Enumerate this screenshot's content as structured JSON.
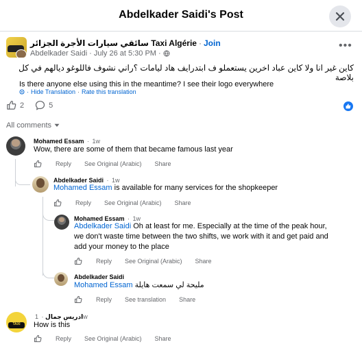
{
  "header": {
    "title": "Abdelkader Saidi's Post"
  },
  "post": {
    "group_name": "سائقي سيارات الأجرة الجزائر Taxi Algérie",
    "join_label": "Join",
    "author": "Abdelkader Saidi",
    "timestamp": "July 26 at 5:30 PM",
    "text": "كاين غير انا ولا كاين عباد اخرين يستعملو ف ابتدرايف هاد ليامات ؟راني نشوف فاللوغو ديالهم في كل بلاصة",
    "translation": "Is there anyone else using this in the meantime? I see their logo everywhere",
    "hide_translation": "Hide Translation",
    "rate_translation": "Rate this translation",
    "like_count": "2",
    "comment_count": "5"
  },
  "comments_filter": {
    "label": "All comments"
  },
  "comments": [
    {
      "author": "Mohamed Essam",
      "time": "1w",
      "text": "Wow, there are some of them that became famous last year",
      "actions": [
        "Reply",
        "See Original (Arabic)",
        "Share"
      ]
    },
    {
      "author": "Abdelkader Saidi",
      "time": "1w",
      "mention": "Mohamed Essam",
      "text": " is available for many services for the shopkeeper",
      "actions": [
        "Reply",
        "See Original (Arabic)",
        "Share"
      ]
    },
    {
      "author": "Mohamed Essam",
      "time": "1w",
      "mention": "Abdelkader Saidi",
      "text_line1": " Oh at least for me. Especially at the time of the peak hour,",
      "text_line2": "we don't waste time between the two shifts, we work with it and get paid and",
      "text_line3": "add your money to the place",
      "actions": [
        "Reply",
        "See Original (Arabic)",
        "Share"
      ]
    },
    {
      "author": "Abdelkader Saidi",
      "mention": "Mohamed Essam",
      "text": " مليحة لي سمعت هايلة",
      "actions": [
        "Reply",
        "See translation",
        "Share"
      ]
    },
    {
      "author": "ادريس جمال",
      "time": "1w",
      "text": "How is this",
      "actions": [
        "Reply",
        "See Original (Arabic)",
        "Share"
      ]
    }
  ],
  "icons": {
    "close": "close-icon",
    "more": "more-options-icon",
    "globe": "globe-icon",
    "like": "like-icon",
    "comment": "comment-bubble-icon",
    "chevron": "chevron-down-icon"
  },
  "colors": {
    "link": "#0064d1",
    "muted": "#65676b",
    "accent_like": "#1877f2"
  }
}
